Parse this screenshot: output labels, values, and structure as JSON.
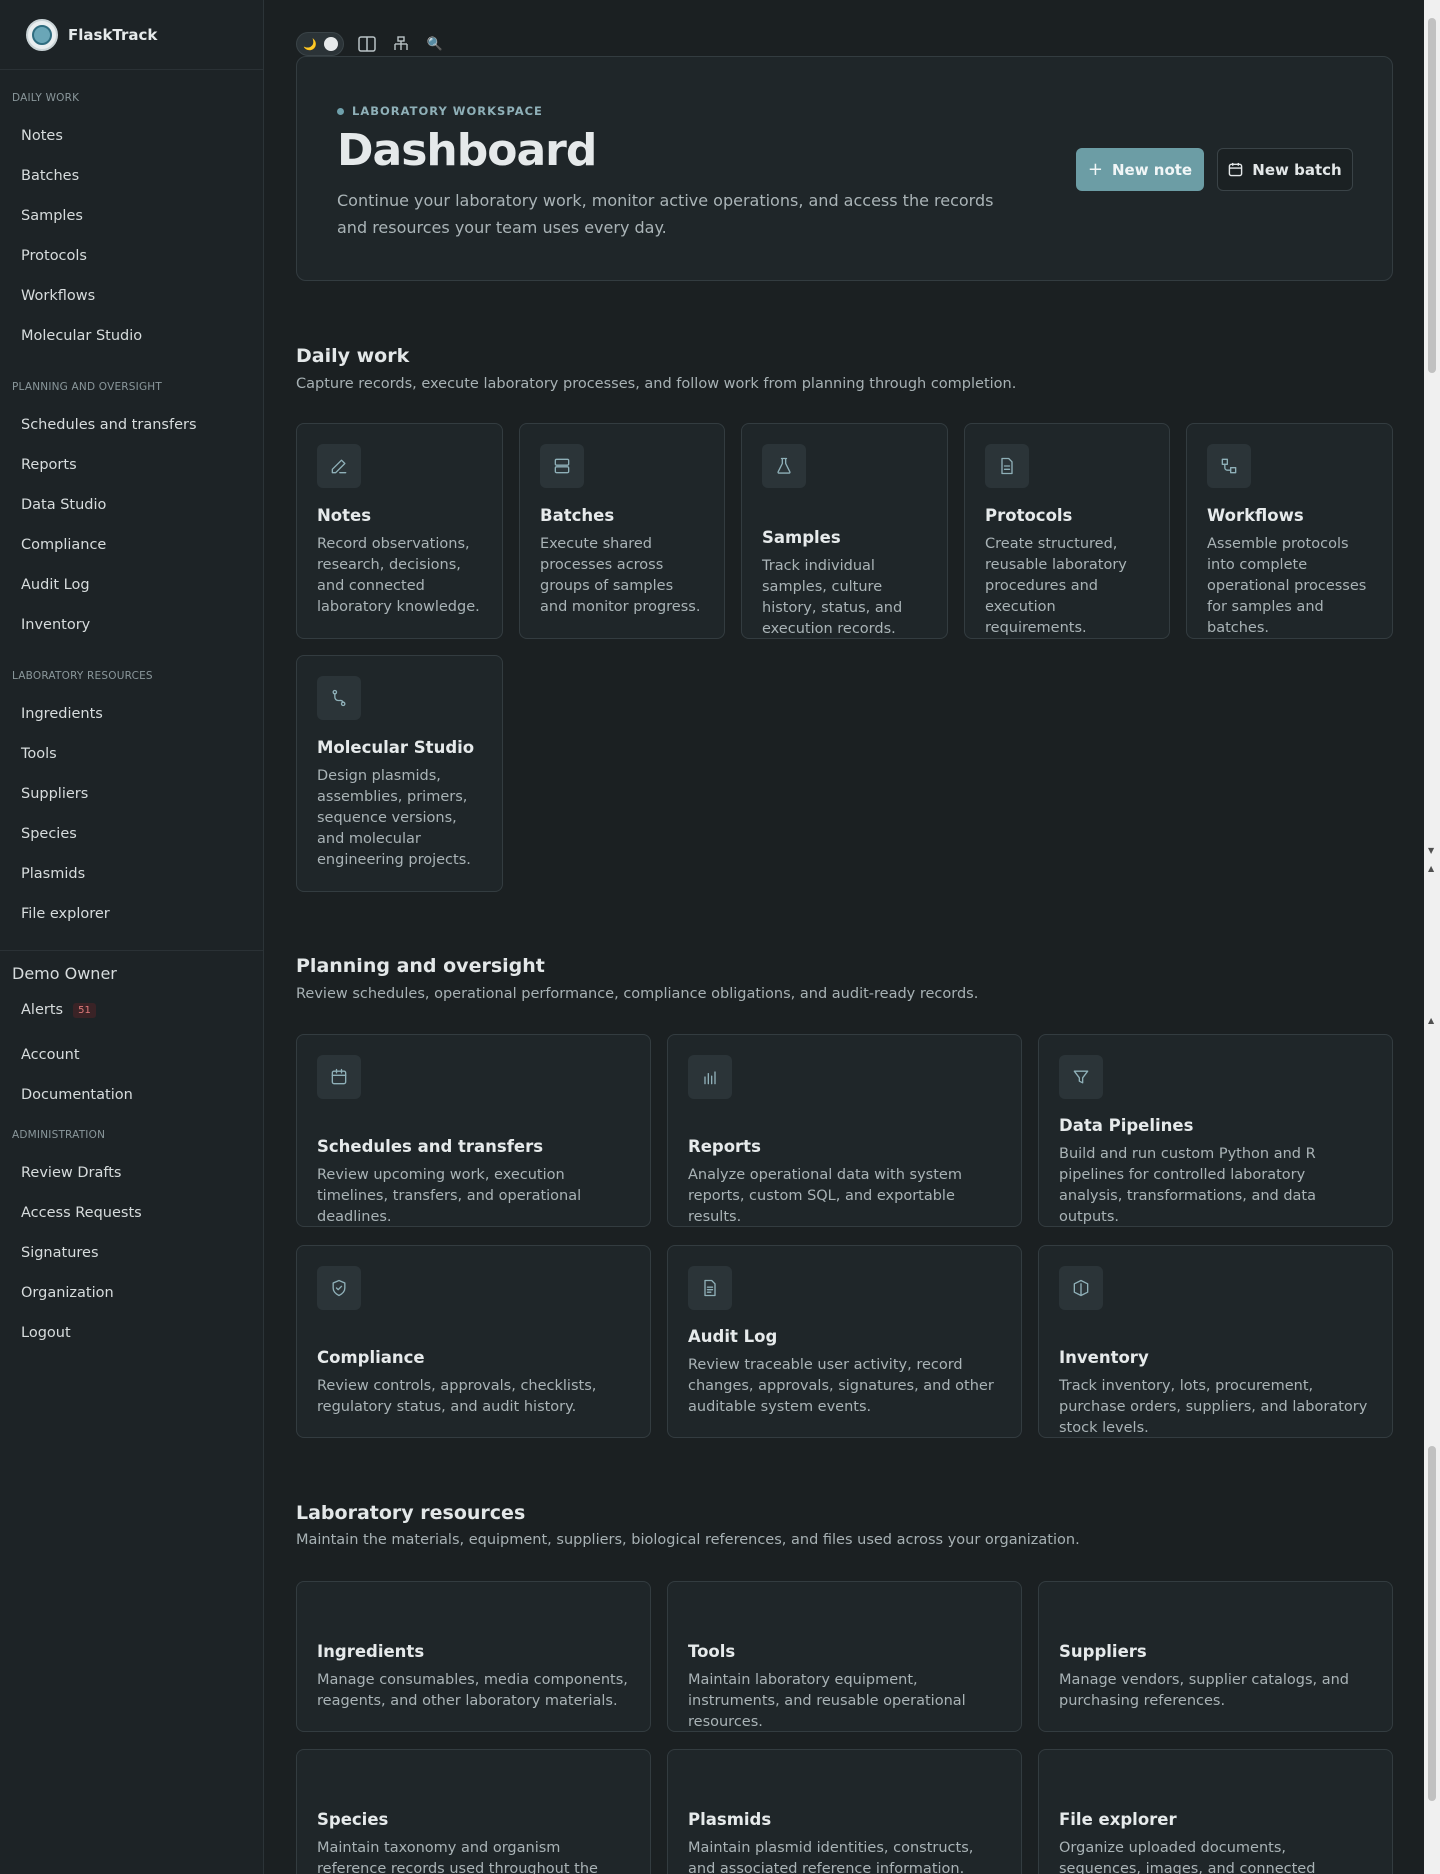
{
  "brand": {
    "name": "FlaskTrack"
  },
  "sidebar": {
    "sections": [
      {
        "label": "Daily work",
        "items": [
          "Notes",
          "Batches",
          "Samples",
          "Protocols",
          "Workflows",
          "Molecular Studio"
        ]
      },
      {
        "label": "Planning and oversight",
        "items": [
          "Schedules and transfers",
          "Reports",
          "Data Studio",
          "Compliance",
          "Audit Log",
          "Inventory"
        ]
      },
      {
        "label": "Laboratory resources",
        "items": [
          "Ingredients",
          "Tools",
          "Suppliers",
          "Species",
          "Plasmids",
          "File explorer"
        ]
      }
    ],
    "owner": "Demo Owner",
    "alerts_label": "Alerts",
    "alerts_count": "51",
    "account": "Account",
    "documentation": "Documentation",
    "admin_label": "Administration",
    "admin_items": [
      "Review Drafts",
      "Access Requests",
      "Signatures",
      "Organization",
      "Logout"
    ]
  },
  "toolbar": {
    "theme_icon": "moon-icon",
    "icons": [
      "panel-icon",
      "sitemap-icon",
      "search-icon"
    ]
  },
  "hero": {
    "eyebrow": "LABORATORY WORKSPACE",
    "title": "Dashboard",
    "subtitle": "Continue your laboratory work, monitor active operations, and access the records and resources your team uses every day.",
    "new_note": "New note",
    "new_batch": "New batch"
  },
  "sections": {
    "daily": {
      "title": "Daily work",
      "subtitle": "Capture records, execute laboratory processes, and follow work from planning through completion.",
      "cards": [
        {
          "title": "Notes",
          "desc": "Record observations, research, decisions, and connected laboratory knowledge.",
          "icon": "pencil-icon"
        },
        {
          "title": "Batches",
          "desc": "Execute shared processes across groups of samples and monitor progress.",
          "icon": "server-icon"
        },
        {
          "title": "Samples",
          "desc": "Track individual samples, culture history, status, and execution records.",
          "icon": "flask-icon"
        },
        {
          "title": "Protocols",
          "desc": "Create structured, reusable laboratory procedures and execution requirements.",
          "icon": "document-icon"
        },
        {
          "title": "Workflows",
          "desc": "Assemble protocols into complete operational processes for samples and batches.",
          "icon": "workflow-icon"
        },
        {
          "title": "Molecular Studio",
          "desc": "Design plasmids, assemblies, primers, sequence versions, and molecular engineering projects.",
          "icon": "route-icon"
        }
      ]
    },
    "planning": {
      "title": "Planning and oversight",
      "subtitle": "Review schedules, operational performance, compliance obligations, and audit-ready records.",
      "cards": [
        {
          "title": "Schedules and transfers",
          "desc": "Review upcoming work, execution timelines, transfers, and operational deadlines.",
          "icon": "calendar-icon"
        },
        {
          "title": "Reports",
          "desc": "Analyze operational data with system reports, custom SQL, and exportable results.",
          "icon": "bar-chart-icon"
        },
        {
          "title": "Data Pipelines",
          "desc": "Build and run custom Python and R pipelines for controlled laboratory analysis, transformations, and data outputs.",
          "icon": "filter-icon"
        },
        {
          "title": "Compliance",
          "desc": "Review controls, approvals, checklists, regulatory status, and audit history.",
          "icon": "shield-icon"
        },
        {
          "title": "Audit Log",
          "desc": "Review traceable user activity, record changes, approvals, signatures, and other auditable system events.",
          "icon": "file-text-icon"
        },
        {
          "title": "Inventory",
          "desc": "Track inventory, lots, procurement, purchase orders, suppliers, and laboratory stock levels.",
          "icon": "box-icon"
        }
      ]
    },
    "resources": {
      "title": "Laboratory resources",
      "subtitle": "Maintain the materials, equipment, suppliers, biological references, and files used across your organization.",
      "cards": [
        {
          "title": "Ingredients",
          "desc": "Manage consumables, media components, reagents, and other laboratory materials."
        },
        {
          "title": "Tools",
          "desc": "Maintain laboratory equipment, instruments, and reusable operational resources."
        },
        {
          "title": "Suppliers",
          "desc": "Manage vendors, supplier catalogs, and purchasing references."
        },
        {
          "title": "Species",
          "desc": "Maintain taxonomy and organism reference records used throughout the laboratory."
        },
        {
          "title": "Plasmids",
          "desc": "Maintain plasmid identities, constructs, and associated reference information."
        },
        {
          "title": "File explorer",
          "desc": "Organize uploaded documents, sequences, images, and connected laboratory files."
        }
      ]
    }
  }
}
